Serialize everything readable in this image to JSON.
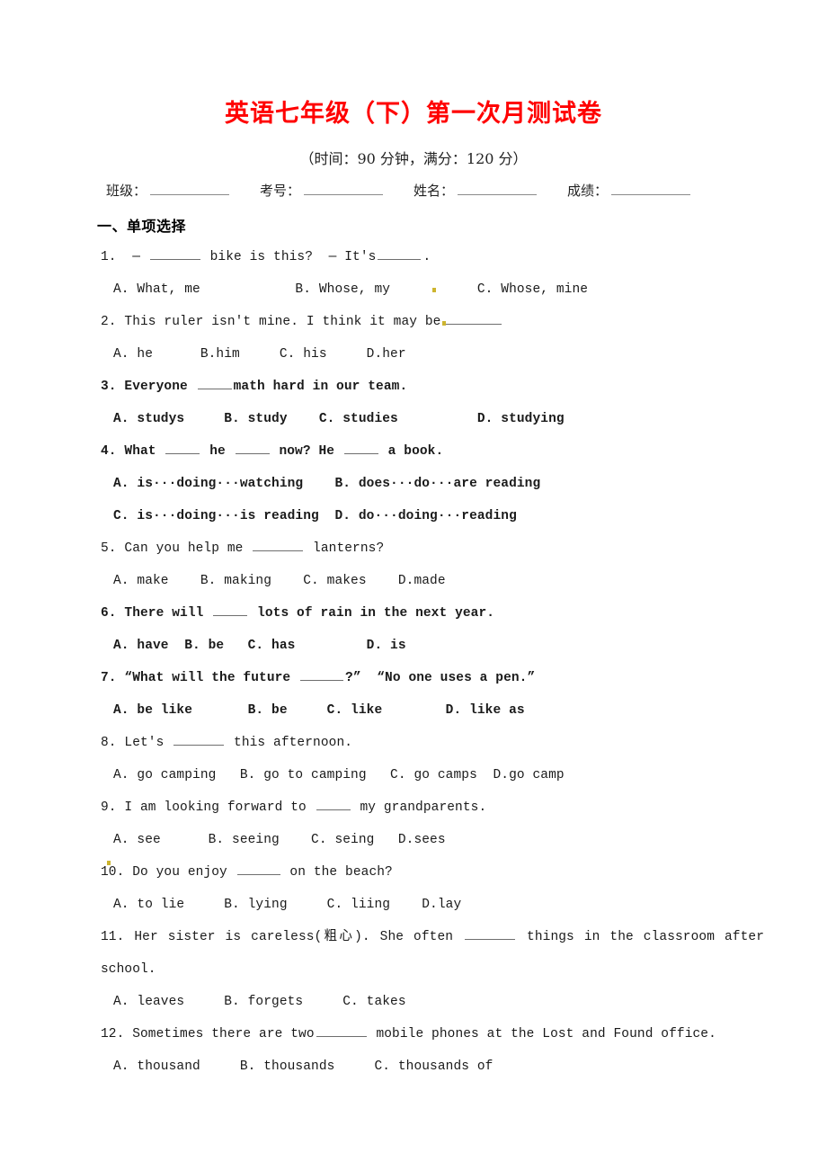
{
  "document": {
    "title": "英语七年级（下）第一次月测试卷",
    "subtitle": "（时间：90 分钟，满分：120 分）",
    "title_color": "#ff0000"
  },
  "info_line": {
    "fields": [
      {
        "label": "班级："
      },
      {
        "label": "考号："
      },
      {
        "label": "姓名："
      },
      {
        "label": "成绩："
      }
    ]
  },
  "section": {
    "heading": "一、单项选择"
  },
  "questions": [
    {
      "number": "1.",
      "stem_before": "1.  — ",
      "stem_after": " bike is this?  — It's",
      "stem_end": ".",
      "options_line": "A. What, me            B. Whose, my           C. Whose, mine",
      "bold": false
    },
    {
      "number": "2.",
      "stem_before": "2. This ruler isn't mine. I think it may be",
      "options_line": "A. he      B.him     C. his     D.her",
      "bold": false
    },
    {
      "number": "3.",
      "stem_before": "3. Everyone ",
      "stem_after": "math hard in our team.",
      "options_line": "A. studys     B. study    C. studies          D. studying",
      "bold": true
    },
    {
      "number": "4.",
      "stem_before": "4. What ",
      "stem_mid1": " he ",
      "stem_mid2": " now? He ",
      "stem_after": " a book.",
      "options_line_1": "A. is···doing···watching    B. does···do···are reading",
      "options_line_2": "C. is···doing···is reading  D. do···doing···reading",
      "bold": true
    },
    {
      "number": "5.",
      "stem_before": "5. Can you help me ",
      "stem_after": " lanterns?",
      "options_line": "A. make    B. making    C. makes    D.made",
      "bold": false
    },
    {
      "number": "6.",
      "stem_before": "6. There will ",
      "stem_after": " lots of rain in the next year.",
      "options_line": "A. have  B. be   C. has         D. is",
      "bold": true
    },
    {
      "number": "7.",
      "stem_before": "7. “What will the future ",
      "stem_after": "?”  “No one uses a pen.”",
      "options_line": "A. be like       B. be     C. like        D. like as",
      "bold": true
    },
    {
      "number": "8.",
      "stem_before": "8. Let's ",
      "stem_after": " this afternoon.",
      "options_line": "A. go camping   B. go to camping   C. go camps  D.go camp",
      "bold": false
    },
    {
      "number": "9.",
      "stem_before": "9. I am looking forward to ",
      "stem_after": " my grandparents.",
      "options_line": "A. see      B. seeing    C. seing   D.sees",
      "bold": false
    },
    {
      "number": "10.",
      "stem_before": "10. Do you enjoy ",
      "stem_after": " on the beach?",
      "options_line": "A. to lie     B. lying     C. liing    D.lay",
      "bold": false
    },
    {
      "number": "11.",
      "stem_before": "11. Her sister is careless(粗心). She often ",
      "stem_after": " things in the classroom after school.",
      "options_line": "A. leaves     B. forgets     C. takes",
      "bold": false
    },
    {
      "number": "12.",
      "stem_before": "12. Sometimes there are two",
      "stem_after": " mobile phones at the Lost and Found office.",
      "options_line": "A. thousand     B. thousands     C. thousands of",
      "bold": false
    }
  ]
}
